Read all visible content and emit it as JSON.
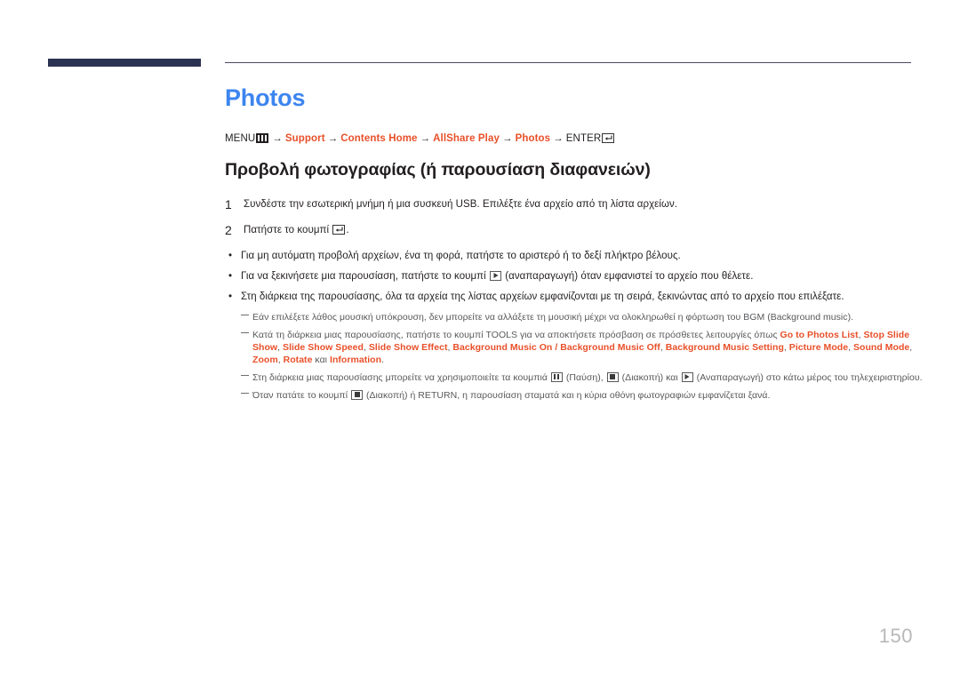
{
  "document": {
    "title": "Photos",
    "title_color": "#3d85f0",
    "accent_color": "#e8502a",
    "page_number": "150"
  },
  "menu_path": {
    "menu_label": "MENU",
    "menu_icon": "menu-grid-icon",
    "arrow": "→",
    "items": [
      {
        "label": "Support",
        "highlight": true
      },
      {
        "label": "Contents Home",
        "highlight": true
      },
      {
        "label": "AllShare Play",
        "highlight": true
      },
      {
        "label": "Photos",
        "highlight": true
      }
    ],
    "enter_label": "ENTER",
    "enter_icon": "enter-return-icon"
  },
  "section": {
    "heading": "Προβολή φωτογραφίας (ή παρουσίαση διαφανειών)"
  },
  "steps": [
    {
      "number": "1",
      "text": "Συνδέστε την εσωτερική μνήμη ή μια συσκευή USB. Επιλέξτε ένα αρχείο από τη λίστα αρχείων."
    },
    {
      "number": "2",
      "text_before": "Πατήστε το κουμπί ",
      "icon": "enter-return-icon",
      "text_after": "."
    }
  ],
  "bullets": [
    {
      "marker": "•",
      "text": "Για μη αυτόματη προβολή αρχείων, ένα τη φορά, πατήστε το αριστερό ή το δεξί πλήκτρο βέλους."
    },
    {
      "marker": "•",
      "text_before": "Για να ξεκινήσετε μια παρουσίαση, πατήστε το κουμπί ",
      "icon": "play-icon",
      "text_after": " (αναπαραγωγή) όταν εμφανιστεί το αρχείο που θέλετε."
    },
    {
      "marker": "•",
      "text": "Στη διάρκεια της παρουσίασης, όλα τα αρχεία της λίστας αρχείων εμφανίζονται με τη σειρά, ξεκινώντας από το αρχείο που επιλέξατε."
    }
  ],
  "notes": [
    {
      "id": "note-bgm",
      "text": "Εάν επιλέξετε λάθος μουσική υπόκρουση, δεν μπορείτε να αλλάξετε τη μουσική μέχρι να ολοκληρωθεί η φόρτωση του BGM (Background music)."
    },
    {
      "id": "note-tools",
      "intro": "Κατά τη διάρκεια μιας παρουσίασης, πατήστε το κουμπί TOOLS για να αποκτήσετε πρόσβαση σε πρόσθετες λειτουργίες όπως ",
      "options": [
        "Go to Photos List",
        "Stop Slide Show",
        "Slide Show Speed",
        "Slide Show Effect",
        "Background Music On / Background Music Off",
        "Background Music Setting",
        "Picture Mode",
        "Sound Mode",
        "Zoom",
        "Rotate"
      ],
      "conjunction": "και",
      "last_option": "Information",
      "outro": "."
    },
    {
      "id": "note-transport",
      "text_before": "Στη διάρκεια μιας παρουσίασης μπορείτε να χρησιμοποιείτε τα κουμπιά ",
      "pause_icon": "pause-icon",
      "pause_label": " (Παύση), ",
      "stop_icon": "stop-icon",
      "stop_label": " (Διακοπή) και ",
      "play_icon": "play-icon",
      "play_label": " (Αναπαραγωγή) στο κάτω μέρος του τηλεχειριστηρίου."
    },
    {
      "id": "note-return",
      "text_before": "Όταν πατάτε το κουμπί ",
      "stop_icon": "stop-icon",
      "text_after": " (Διακοπή) ή RETURN, η παρουσίαση σταματά και η κύρια οθόνη φωτογραφιών εμφανίζεται ξανά."
    }
  ]
}
